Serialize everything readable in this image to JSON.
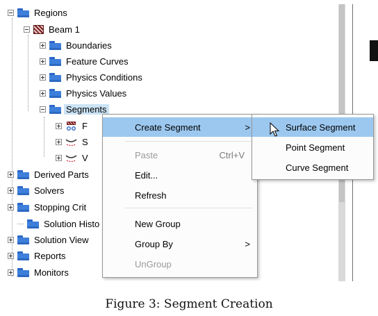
{
  "tree": {
    "regions": "Regions",
    "beam": "Beam 1",
    "boundaries": "Boundaries",
    "feature_curves": "Feature Curves",
    "physics_conditions": "Physics Conditions",
    "physics_values": "Physics Values",
    "segments": "Segments",
    "seg_child_1": "F",
    "seg_child_2": "S",
    "seg_child_3": "V",
    "derived_parts": "Derived Parts",
    "solvers": "Solvers",
    "stopping_criteria": "Stopping Crit",
    "solution_histories": "Solution Histo",
    "solution_views": "Solution View",
    "reports": "Reports",
    "monitors": "Monitors"
  },
  "context_menu": {
    "create_segment": "Create Segment",
    "paste": "Paste",
    "paste_shortcut": "Ctrl+V",
    "edit": "Edit...",
    "refresh": "Refresh",
    "new_group": "New Group",
    "group_by": "Group By",
    "ungroup": "UnGroup",
    "submenu_arrow": ">"
  },
  "submenu": {
    "surface_segment": "Surface Segment",
    "point_segment": "Point Segment",
    "curve_segment": "Curve Segment"
  },
  "caption": "Figure 3: Segment Creation",
  "colors": {
    "highlight": "#9cc8f0",
    "selection": "#cbe3f5",
    "folder": "#3d7fdb"
  }
}
